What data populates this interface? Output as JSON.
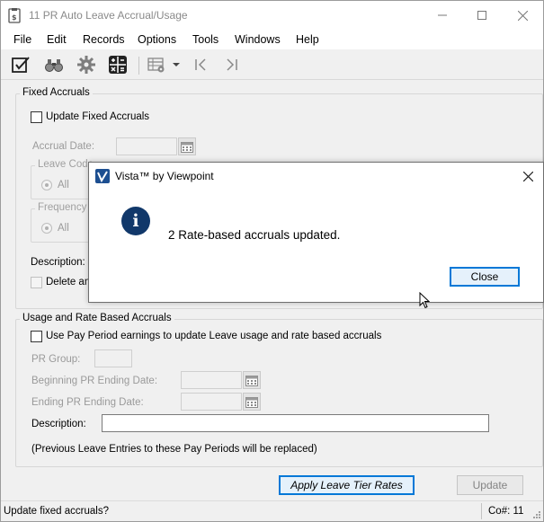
{
  "window": {
    "title": "11 PR Auto Leave Accrual/Usage"
  },
  "menu": {
    "items": [
      "File",
      "Edit",
      "Records",
      "Options",
      "Tools",
      "Windows",
      "Help"
    ]
  },
  "toolbar": {
    "icons": [
      "edit-checkbox-icon",
      "binoculars-icon",
      "settings-gear-icon",
      "calculator-icon",
      "grid-options-icon",
      "dropdown-arrow-icon",
      "first-record-icon",
      "last-record-icon"
    ]
  },
  "fixed_accruals": {
    "title": "Fixed Accruals",
    "update_label": "Update Fixed Accruals",
    "accrual_date_label": "Accrual Date:",
    "leave_code_title": "Leave Code",
    "leave_code_all": "All",
    "frequency_title": "Frequency",
    "frequency_all": "All",
    "description_label": "Description:",
    "delete_label": "Delete any"
  },
  "usage": {
    "title": "Usage and Rate Based Accruals",
    "use_pay_period_label": "Use Pay Period earnings to update Leave usage and rate based accruals",
    "pr_group_label": "PR Group:",
    "beginning_label": "Beginning PR Ending Date:",
    "ending_label": "Ending PR Ending Date:",
    "description_label": "Description:",
    "note": "(Previous Leave Entries to these Pay Periods will be replaced)"
  },
  "buttons": {
    "apply_tier": "Apply Leave Tier Rates",
    "update": "Update"
  },
  "status": {
    "message": "Update fixed accruals?",
    "company": "Co#: 11"
  },
  "dialog": {
    "title": "Vista™ by Viewpoint",
    "message": "2 Rate-based accruals updated.",
    "close_button": "Close"
  },
  "colors": {
    "accent": "#0078d7",
    "info_icon": "#11386a",
    "window_bg": "#f0f0f0"
  }
}
